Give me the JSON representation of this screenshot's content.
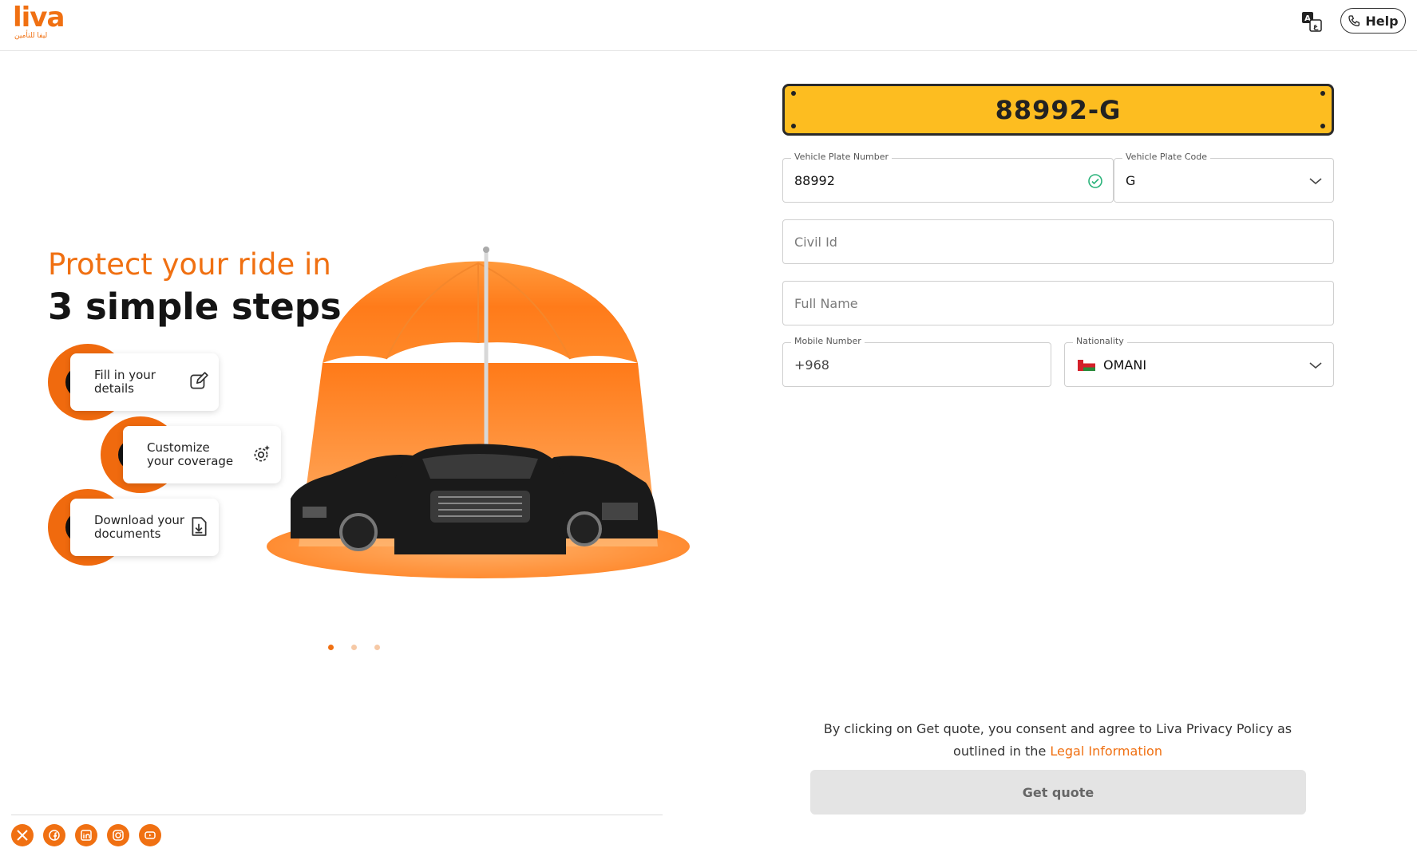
{
  "header": {
    "logo_text": "liva",
    "logo_arabic": "ليفا للتأمين",
    "help_label": "Help"
  },
  "promo": {
    "title_line1": "Protect your ride in",
    "title_line2": "3 simple steps",
    "steps": [
      {
        "number": "1",
        "line1": "Fill in your",
        "line2": "details",
        "icon": "edit-icon"
      },
      {
        "number": "2",
        "line1": "Customize",
        "line2": "your coverage",
        "icon": "gear-sparkle-icon"
      },
      {
        "number": "3",
        "line1": "Download your",
        "line2": "documents",
        "icon": "download-document-icon"
      }
    ],
    "carousel_active_index": 0,
    "carousel_count": 3
  },
  "form": {
    "plate_display": "88992-G",
    "plate_number": {
      "label": "Vehicle Plate Number",
      "value": "88992"
    },
    "plate_code": {
      "label": "Vehicle Plate Code",
      "value": "G"
    },
    "civil_id": {
      "placeholder": "Civil Id"
    },
    "full_name": {
      "placeholder": "Full Name"
    },
    "mobile": {
      "label": "Mobile Number",
      "value": "+968"
    },
    "nationality": {
      "label": "Nationality",
      "value": "OMANI"
    },
    "consent_text": "By clicking on Get quote, you consent and agree to Liva Privacy Policy as outlined in the",
    "consent_link": "Legal Information",
    "submit_label": "Get quote"
  },
  "socials": [
    "x-icon",
    "facebook-icon",
    "linkedin-icon",
    "instagram-icon",
    "youtube-icon"
  ],
  "colors": {
    "brand": "#f07012",
    "plate": "#fdbd20",
    "success": "#2ab37a"
  }
}
